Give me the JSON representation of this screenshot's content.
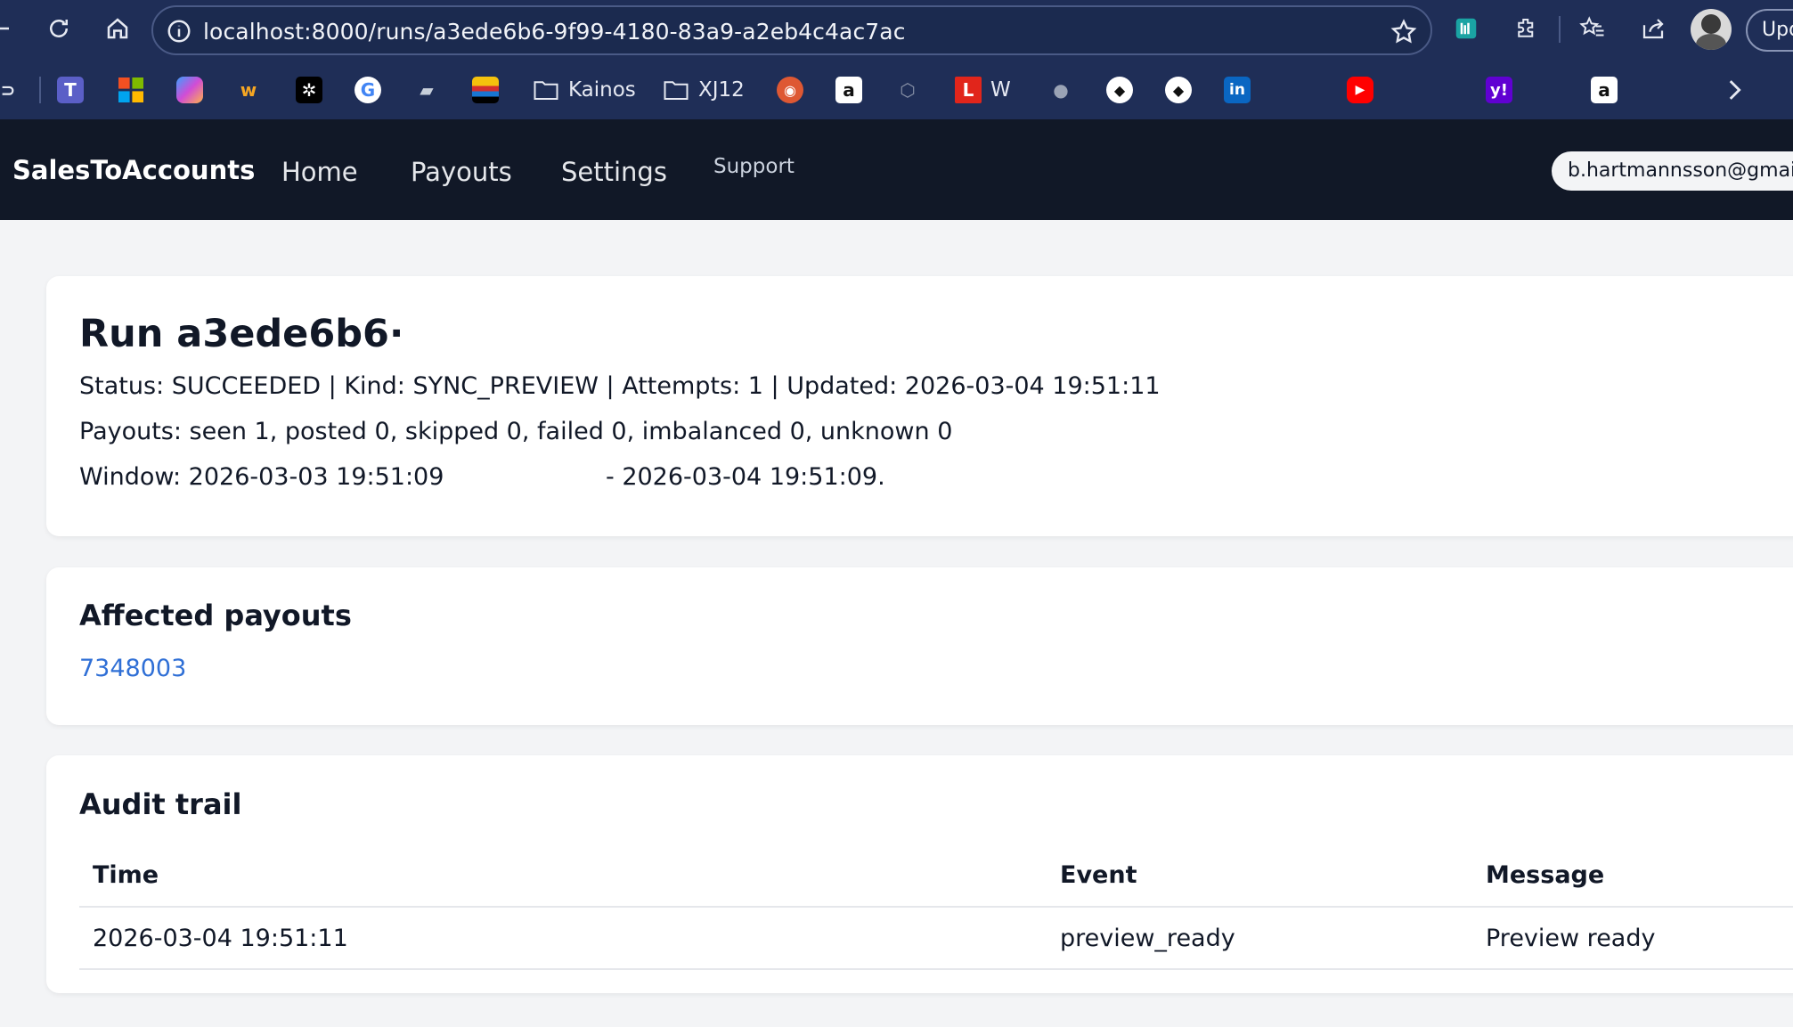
{
  "browser": {
    "url": "localhost:8000/runs/a3ede6b6-9f99-4180-83a9-a2eb4c4ac7ac",
    "update_label": "Upd",
    "bookmarks": [
      {
        "icon": "teams-icon",
        "label": ""
      },
      {
        "icon": "microsoft-icon",
        "label": ""
      },
      {
        "icon": "copilot-icon",
        "label": ""
      },
      {
        "icon": "workday-icon",
        "label": ""
      },
      {
        "icon": "puzzle-app-icon",
        "label": ""
      },
      {
        "icon": "google-icon",
        "label": ""
      },
      {
        "icon": "books-icon",
        "label": ""
      },
      {
        "icon": "shop-icon",
        "label": ""
      },
      {
        "icon": "folder-icon",
        "label": "Kainos"
      },
      {
        "icon": "folder-icon",
        "label": "XJ12"
      },
      {
        "icon": "duckduckgo-icon",
        "label": ""
      },
      {
        "icon": "amazon-icon",
        "label": ""
      },
      {
        "icon": "chatgpt-icon",
        "label": ""
      },
      {
        "icon": "l-app-icon",
        "label": "W"
      },
      {
        "icon": "apple-icon",
        "label": ""
      },
      {
        "icon": "github-icon",
        "label": ""
      },
      {
        "icon": "github-icon",
        "label": ""
      },
      {
        "icon": "linkedin-icon",
        "label": ""
      },
      {
        "icon": "youtube-icon",
        "label": ""
      },
      {
        "icon": "yahoo-icon",
        "label": ""
      },
      {
        "icon": "amazon-icon",
        "label": ""
      }
    ]
  },
  "app": {
    "brand": "SalesToAccounts",
    "nav": {
      "home": "Home",
      "payouts": "Payouts",
      "settings": "Settings",
      "support": "Support"
    },
    "user_email": "b.hartmannsson@gmail.co"
  },
  "run": {
    "title": "Run a3ede6b6·",
    "status_line": "Status: SUCCEEDED | Kind: SYNC_PREVIEW | Attempts: 1 | Updated: 2026-03-04 19:51:11",
    "payouts_line": "Payouts: seen 1, posted 0, skipped 0, failed 0, imbalanced 0, unknown 0",
    "window_start": "Window: 2026-03-03 19:51:09",
    "window_end": "- 2026-03-04 19:51:09."
  },
  "affected_payouts": {
    "title": "Affected payouts",
    "items": [
      "7348003"
    ]
  },
  "audit_trail": {
    "title": "Audit trail",
    "columns": [
      "Time",
      "Event",
      "Message"
    ],
    "rows": [
      {
        "time": "2026-03-04 19:51:11",
        "event": "preview_ready",
        "message": "Preview ready"
      }
    ]
  },
  "colors": {
    "browser_chrome": "#1f2e57",
    "app_nav": "#111827",
    "page_bg": "#f3f4f6",
    "link": "#2f6fd6"
  }
}
